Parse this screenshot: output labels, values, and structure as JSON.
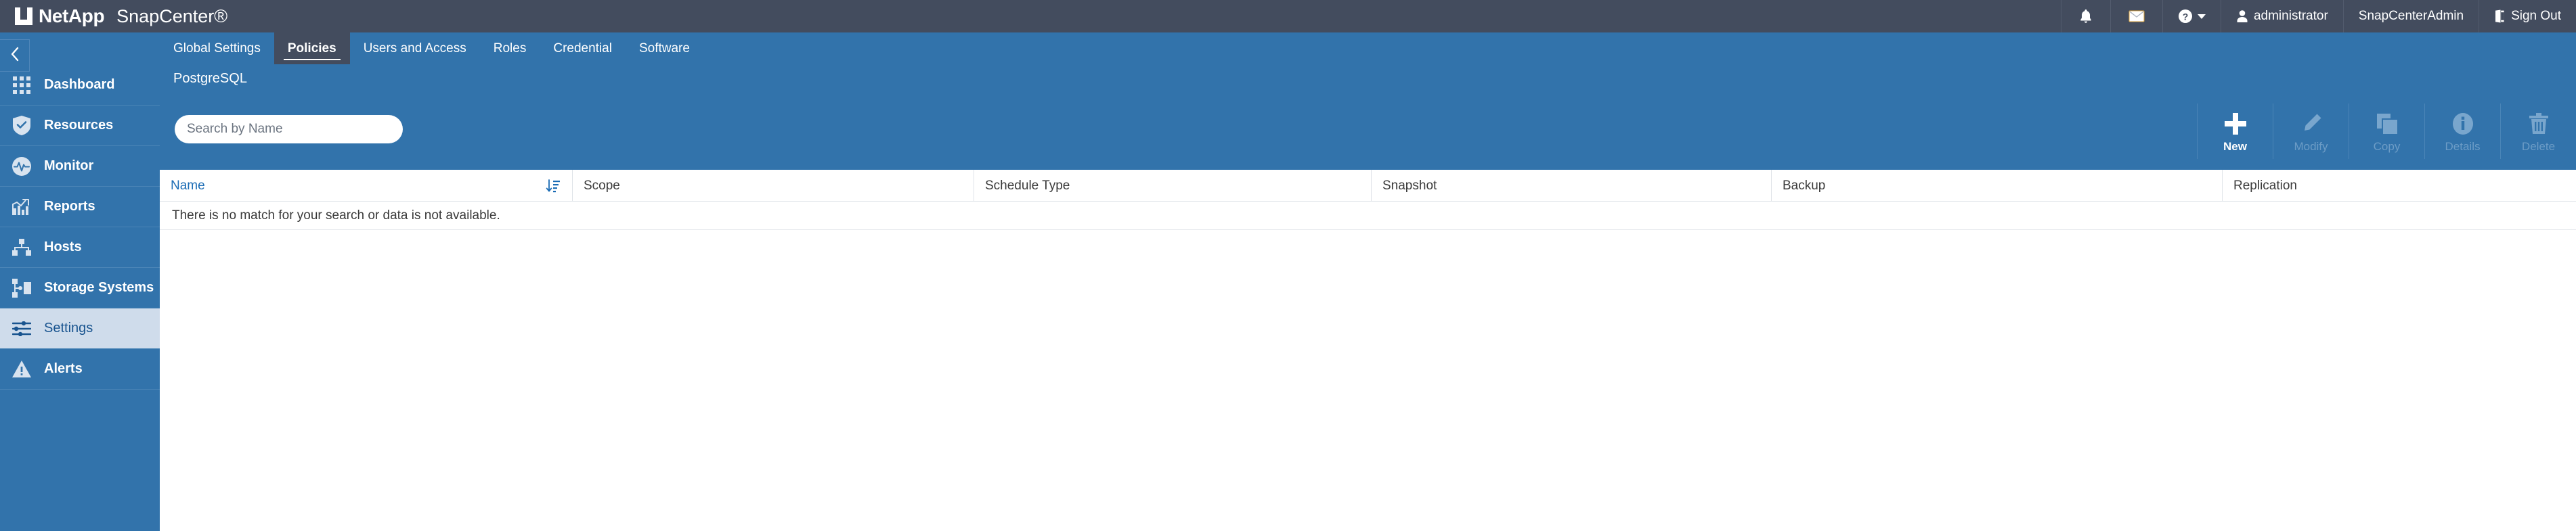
{
  "header": {
    "brand_name": "NetApp",
    "product_name": "SnapCenter®",
    "logo_icon": "netapp-logo-icon",
    "right_items": [
      {
        "icon": "bell-icon",
        "label": ""
      },
      {
        "icon": "envelope-icon",
        "label": ""
      },
      {
        "icon": "help-circle-icon",
        "label": ""
      },
      {
        "icon": "user-icon",
        "label": "administrator"
      },
      {
        "icon": "",
        "label": "SnapCenterAdmin"
      },
      {
        "icon": "sign-out-icon",
        "label": "Sign Out"
      }
    ]
  },
  "sidebar": {
    "collapse_icon": "chevron-left-icon",
    "items": [
      {
        "label": "Dashboard",
        "icon": "grid-icon",
        "active": false
      },
      {
        "label": "Resources",
        "icon": "shield-check-icon",
        "active": false
      },
      {
        "label": "Monitor",
        "icon": "pulse-icon",
        "active": false
      },
      {
        "label": "Reports",
        "icon": "bar-chart-icon",
        "active": false
      },
      {
        "label": "Hosts",
        "icon": "hosts-tree-icon",
        "active": false
      },
      {
        "label": "Storage Systems",
        "icon": "storage-systems-icon",
        "active": false
      },
      {
        "label": "Settings",
        "icon": "sliders-icon",
        "active": true
      },
      {
        "label": "Alerts",
        "icon": "warning-triangle-icon",
        "active": false
      }
    ]
  },
  "main": {
    "tabs": [
      {
        "label": "Global Settings",
        "active": false
      },
      {
        "label": "Policies",
        "active": true
      },
      {
        "label": "Users and Access",
        "active": false
      },
      {
        "label": "Roles",
        "active": false
      },
      {
        "label": "Credential",
        "active": false
      },
      {
        "label": "Software",
        "active": false
      }
    ],
    "section_title": "PostgreSQL",
    "search": {
      "placeholder": "Search by Name",
      "value": ""
    },
    "actions": [
      {
        "label": "New",
        "icon": "plus-icon",
        "enabled": true
      },
      {
        "label": "Modify",
        "icon": "pencil-icon",
        "enabled": false
      },
      {
        "label": "Copy",
        "icon": "copy-icon",
        "enabled": false
      },
      {
        "label": "Details",
        "icon": "info-circle-icon",
        "enabled": false
      },
      {
        "label": "Delete",
        "icon": "trash-icon",
        "enabled": false
      }
    ],
    "table": {
      "columns": [
        {
          "label": "Name",
          "sorted": true,
          "sort_icon": "sort-ascending-icon"
        },
        {
          "label": "Scope",
          "sorted": false
        },
        {
          "label": "Schedule Type",
          "sorted": false
        },
        {
          "label": "Snapshot",
          "sorted": false
        },
        {
          "label": "Backup",
          "sorted": false
        },
        {
          "label": "Replication",
          "sorted": false
        }
      ],
      "rows": [],
      "empty_message": "There is no match for your search or data is not available."
    }
  },
  "colors": {
    "header_bg": "#434c5e",
    "accent_blue": "#3273ab",
    "link_blue": "#1b6cb5",
    "active_nav_bg": "#cfdceb"
  }
}
